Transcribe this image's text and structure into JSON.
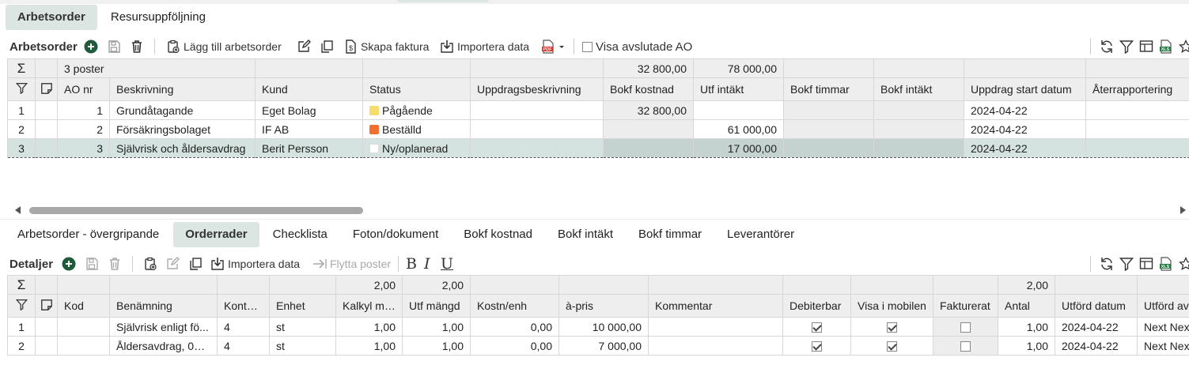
{
  "top_tabs": [
    {
      "label": "Arbetsorder",
      "active": true
    },
    {
      "label": "Resursuppföljning",
      "active": false
    }
  ],
  "toolbar1": {
    "title": "Arbetsorder",
    "add_work_order": "Lägg till arbetsorder",
    "create_invoice": "Skapa faktura",
    "import_data": "Importera data",
    "show_closed": "Visa avslutade AO"
  },
  "grid1": {
    "sum_row": {
      "count": "3 poster",
      "bokf_kostnad": "32 800,00",
      "utf_intakt": "78 000,00"
    },
    "columns": [
      "AO nr",
      "Beskrivning",
      "Kund",
      "Status",
      "Uppdragsbeskrivning",
      "Bokf kostnad",
      "Utf intäkt",
      "Bokf timmar",
      "Bokf intäkt",
      "Uppdrag start datum",
      "Återrapportering"
    ],
    "rows": [
      {
        "rownum": "1",
        "ao_nr": "1",
        "beskrivning": "Grundåtagande",
        "kund": "Eget Bolag",
        "status": "Pågående",
        "status_color": "#f5dc6b",
        "bokf_kostnad": "32 800,00",
        "utf_intakt": "",
        "start": "2024-04-22"
      },
      {
        "rownum": "2",
        "ao_nr": "2",
        "beskrivning": "Försäkringsbolaget",
        "kund": "IF AB",
        "status": "Beställd",
        "status_color": "#f07030",
        "bokf_kostnad": "",
        "utf_intakt": "61 000,00",
        "start": "2024-04-22"
      },
      {
        "rownum": "3",
        "ao_nr": "3",
        "beskrivning": "Självrisk och åldersavdrag",
        "kund": "Berit Persson",
        "status": "Ny/oplanerad",
        "status_color": "#ffffff",
        "bokf_kostnad": "",
        "utf_intakt": "17 000,00",
        "start": "2024-04-22"
      }
    ]
  },
  "bottom_tabs": [
    {
      "label": "Arbetsorder - övergripande",
      "active": false
    },
    {
      "label": "Orderrader",
      "active": true
    },
    {
      "label": "Checklista",
      "active": false
    },
    {
      "label": "Foton/dokument",
      "active": false
    },
    {
      "label": "Bokf kostnad",
      "active": false
    },
    {
      "label": "Bokf intäkt",
      "active": false
    },
    {
      "label": "Bokf timmar",
      "active": false
    },
    {
      "label": "Leverantörer",
      "active": false
    }
  ],
  "toolbar2": {
    "title": "Detaljer",
    "import_data": "Importera data",
    "move_rows": "Flytta poster"
  },
  "grid2": {
    "sum_row": {
      "kalkyl_mgd": "2,00",
      "utf_mangd": "2,00",
      "antal": "2,00"
    },
    "columns": [
      "Kod",
      "Benämning",
      "Kontonr",
      "Enhet",
      "Kalkyl mgd",
      "Utf mängd",
      "Kostn/enh",
      "à-pris",
      "Kommentar",
      "Debiterbar",
      "Visa i mobilen",
      "Fakturerat",
      "Antal",
      "Utförd datum",
      "Utförd av"
    ],
    "rows": [
      {
        "rownum": "1",
        "kod": "",
        "benamning": "Självrisk enligt fö...",
        "kontonr": "4",
        "enhet": "st",
        "kalkyl_mgd": "1,00",
        "utf_mangd": "1,00",
        "kostn_enh": "0,00",
        "a_pris": "10 000,00",
        "kommentar": "",
        "antal": "1,00",
        "utford_datum": "2024-04-22",
        "utford_av": "Next Nexts"
      },
      {
        "rownum": "2",
        "kod": "",
        "benamning": "Åldersavdrag, 0%...",
        "kontonr": "4",
        "enhet": "st",
        "kalkyl_mgd": "1,00",
        "utf_mangd": "1,00",
        "kostn_enh": "0,00",
        "a_pris": "7 000,00",
        "kommentar": "",
        "antal": "1,00",
        "utford_datum": "2024-04-22",
        "utford_av": "Next Nexts"
      }
    ]
  },
  "symbols": {
    "sigma": "Σ",
    "italic": "I",
    "bold": "B",
    "underline": "U"
  }
}
